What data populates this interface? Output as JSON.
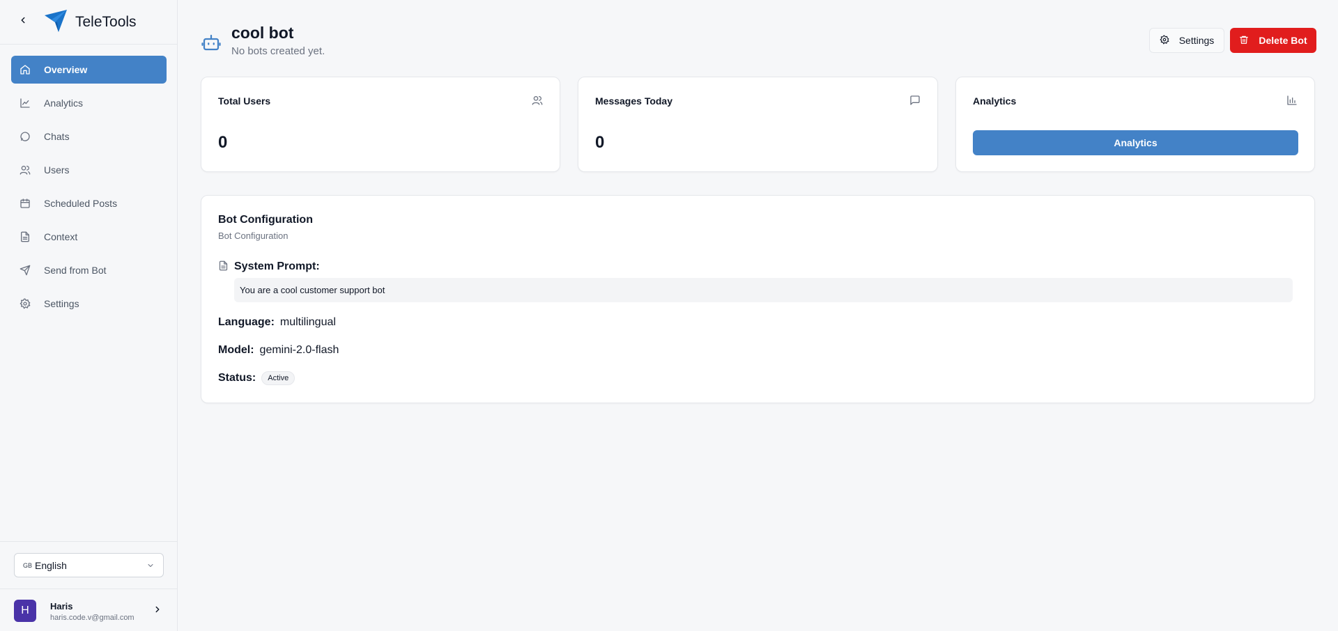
{
  "app": {
    "name": "TeleTools"
  },
  "sidebar": {
    "items": [
      {
        "label": "Overview",
        "icon": "home-icon"
      },
      {
        "label": "Analytics",
        "icon": "line-chart-icon"
      },
      {
        "label": "Chats",
        "icon": "chat-bubble-icon"
      },
      {
        "label": "Users",
        "icon": "users-icon"
      },
      {
        "label": "Scheduled Posts",
        "icon": "calendar-icon"
      },
      {
        "label": "Context",
        "icon": "document-icon"
      },
      {
        "label": "Send from Bot",
        "icon": "send-icon"
      },
      {
        "label": "Settings",
        "icon": "gear-icon"
      }
    ],
    "active": "Overview",
    "language": {
      "code": "GB",
      "label": "English"
    },
    "user": {
      "initial": "H",
      "name": "Haris",
      "email": "haris.code.v@gmail.com"
    }
  },
  "header": {
    "title": "cool bot",
    "subtitle": "No bots created yet.",
    "settings_label": "Settings",
    "delete_label": "Delete Bot"
  },
  "stats": {
    "total_users": {
      "title": "Total Users",
      "value": "0"
    },
    "messages_today": {
      "title": "Messages Today",
      "value": "0"
    },
    "analytics": {
      "title": "Analytics",
      "button_label": "Analytics"
    }
  },
  "config": {
    "title": "Bot Configuration",
    "description": "Bot Configuration",
    "prompt_label": "System Prompt:",
    "prompt_value": "You are a cool customer support bot",
    "language_label": "Language:",
    "language_value": "multilingual",
    "model_label": "Model:",
    "model_value": "gemini-2.0-flash",
    "status_label": "Status:",
    "status_value": "Active"
  },
  "colors": {
    "accent": "#4382c7",
    "danger": "#e11d1d",
    "avatar": "#4a33a8"
  }
}
